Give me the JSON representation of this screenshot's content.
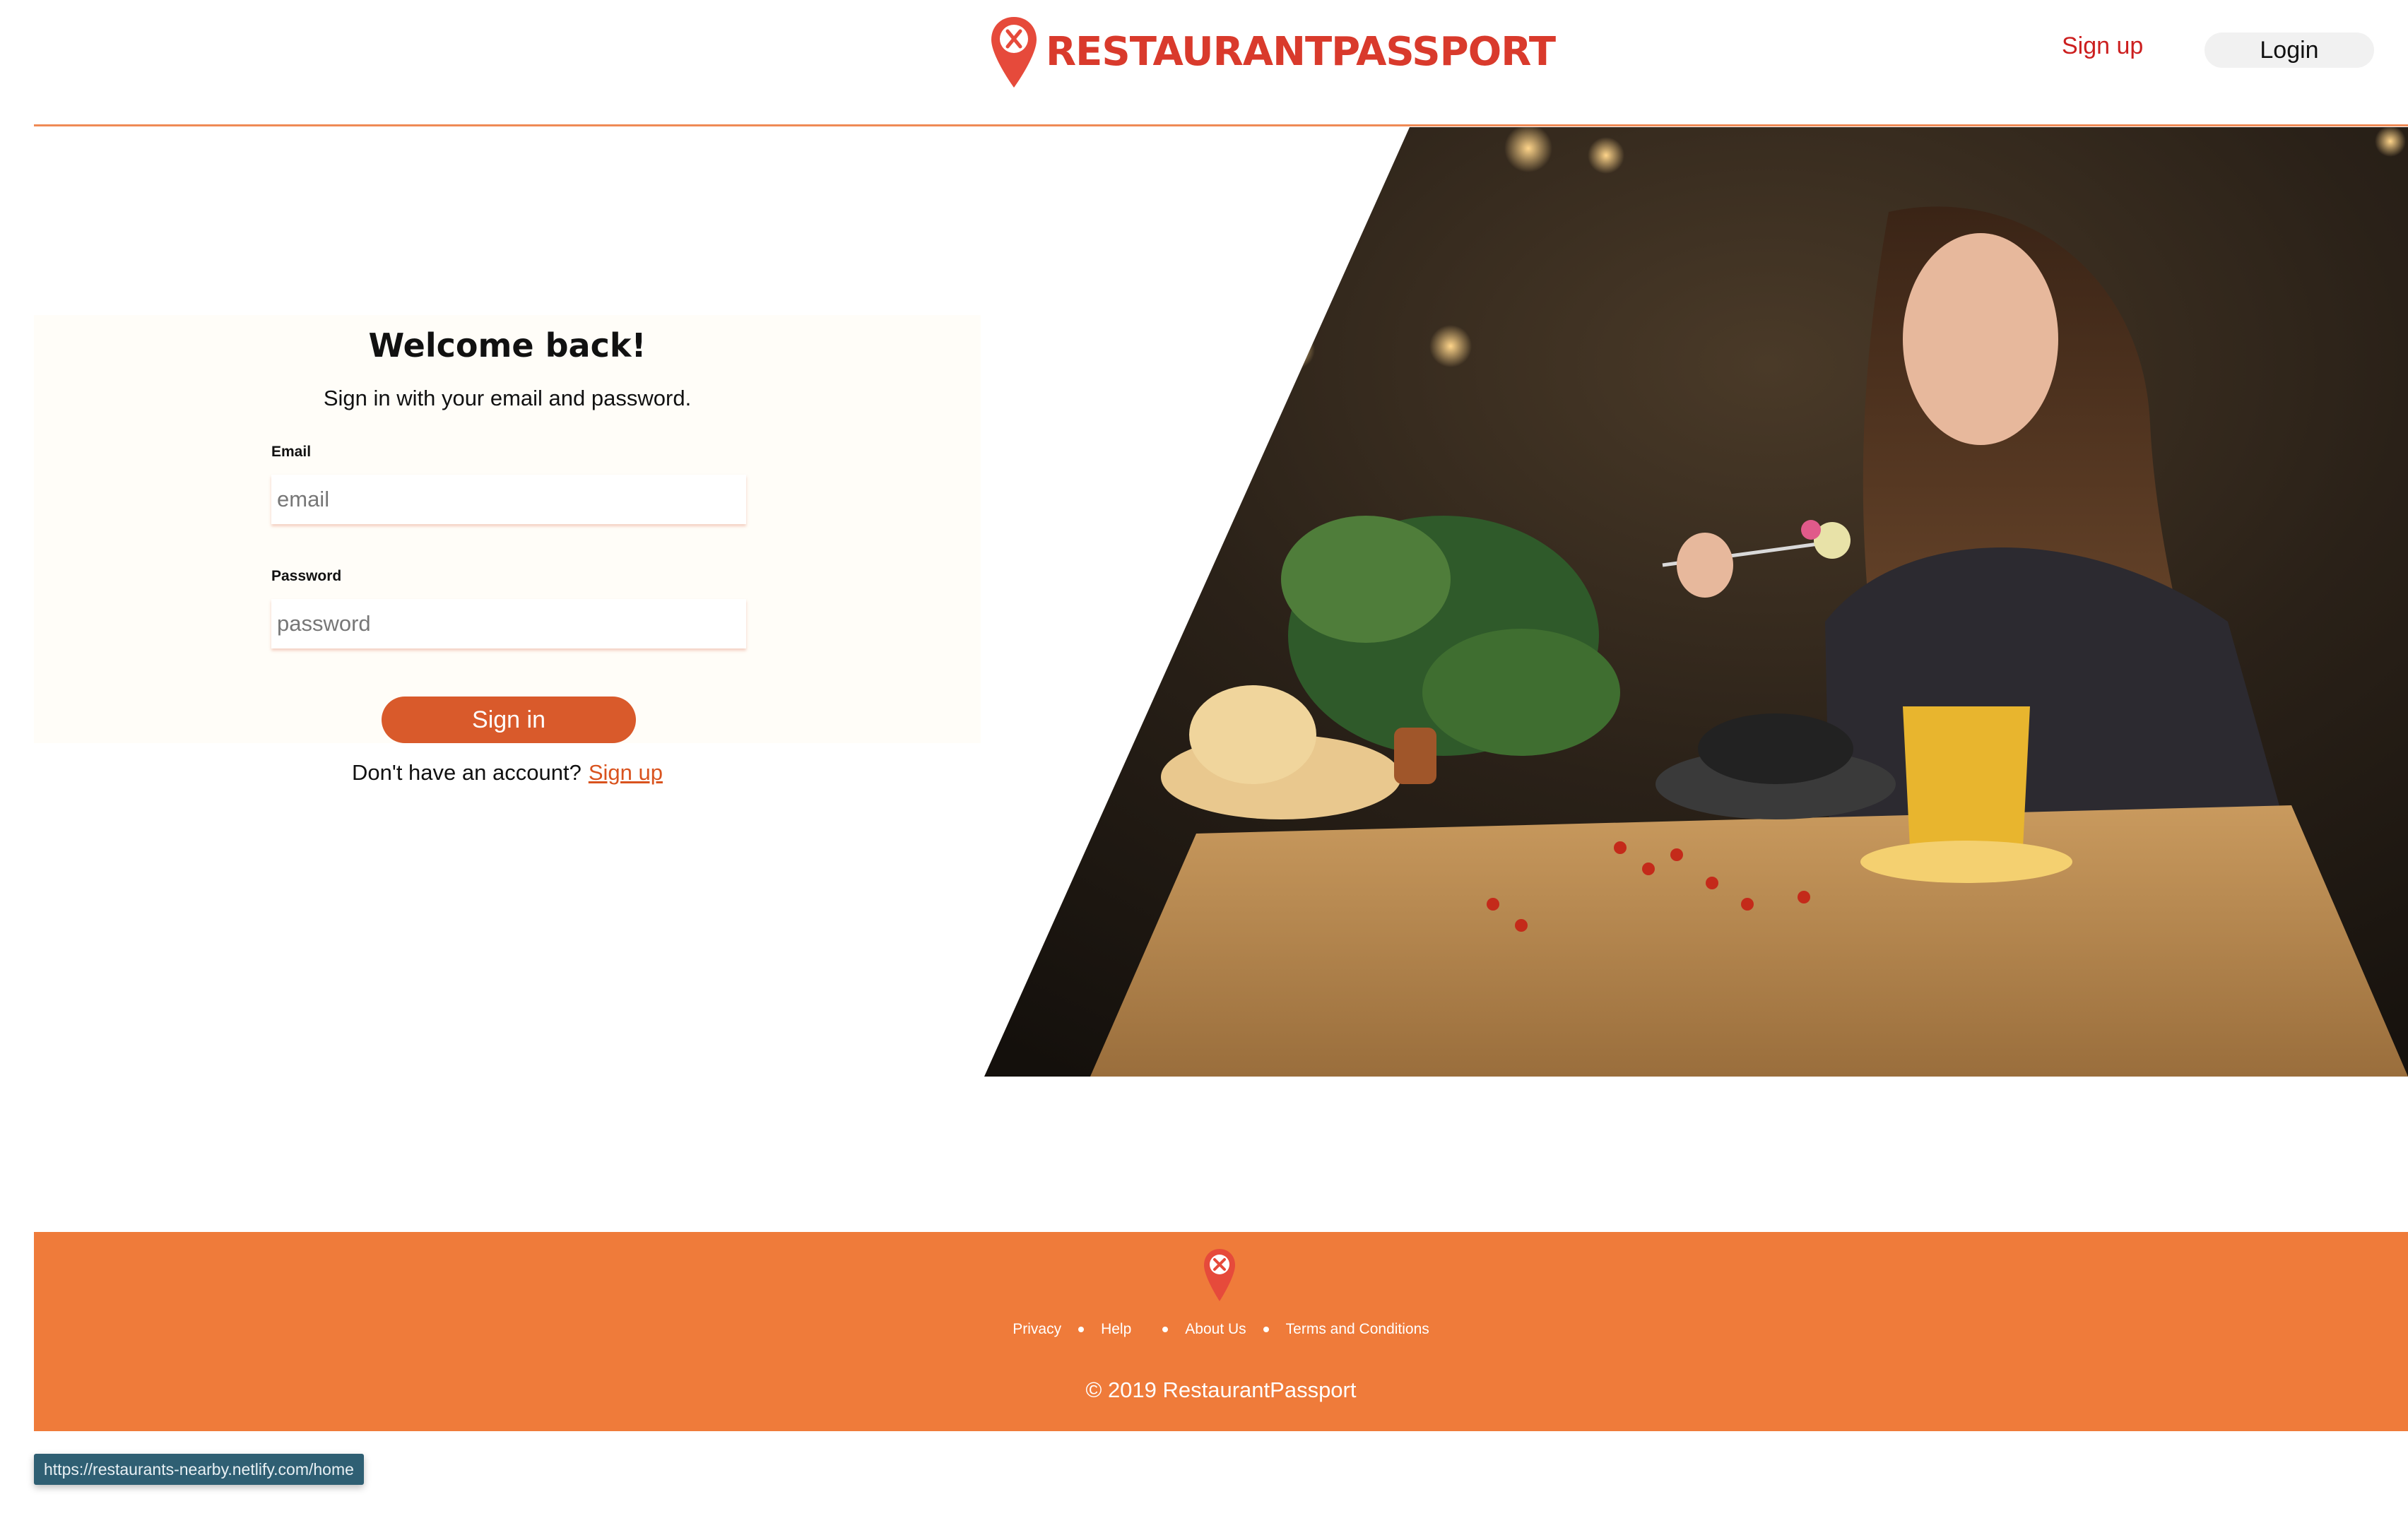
{
  "header": {
    "brand": "RESTAURANTPASSPORT",
    "nav": {
      "signup": "Sign up",
      "login": "Login"
    }
  },
  "form": {
    "title": "Welcome back!",
    "subtitle": "Sign in with your email and password.",
    "email": {
      "label": "Email",
      "placeholder": "email"
    },
    "password": {
      "label": "Password",
      "placeholder": "password"
    },
    "submit": "Sign in",
    "alt_prompt": "Don't have an account?",
    "alt_link": "Sign up"
  },
  "hero": {
    "icon": "photo-woman-dining"
  },
  "footer": {
    "links": [
      "Privacy",
      "Help",
      "About Us",
      "Terms and Conditions"
    ],
    "copyright": "© 2019 RestaurantPassport"
  },
  "status_bar": {
    "url": "https://restaurants-nearby.netlify.com/home"
  },
  "colors": {
    "brand": "#d93a2c",
    "accent": "#ef7b3a",
    "button": "#d95a2b"
  }
}
